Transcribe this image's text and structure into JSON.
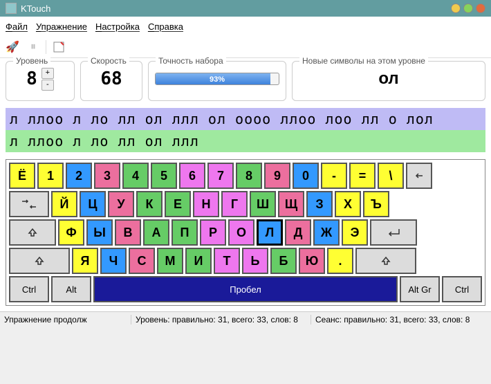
{
  "window": {
    "title": "KTouch"
  },
  "menu": {
    "file": "Файл",
    "exercise": "Упражнение",
    "settings": "Настройка",
    "help": "Справка"
  },
  "stats": {
    "level_label": "Уровень",
    "level_value": "8",
    "speed_label": "Скорость",
    "speed_value": "68",
    "accuracy_label": "Точность набора",
    "accuracy_pct": "93%",
    "accuracy_width": 93,
    "newchars_label": "Новые символы на этом уровне",
    "newchars_value": "ол"
  },
  "typing": {
    "target": "л ллоо л ло лл ол ллл ол оооо ллоо лоо лл о лол",
    "typed": "л ллоо л ло лл ол ллл"
  },
  "keyboard": {
    "rows": [
      [
        {
          "l": "Ё",
          "c": "yellow",
          "w": "1"
        },
        {
          "l": "1",
          "c": "yellow",
          "w": "1"
        },
        {
          "l": "2",
          "c": "blue",
          "w": "1"
        },
        {
          "l": "3",
          "c": "pink",
          "w": "1"
        },
        {
          "l": "4",
          "c": "green",
          "w": "1"
        },
        {
          "l": "5",
          "c": "green",
          "w": "1"
        },
        {
          "l": "6",
          "c": "magenta",
          "w": "1"
        },
        {
          "l": "7",
          "c": "magenta",
          "w": "1"
        },
        {
          "l": "8",
          "c": "green",
          "w": "1"
        },
        {
          "l": "9",
          "c": "pink",
          "w": "1"
        },
        {
          "l": "0",
          "c": "blue",
          "w": "1"
        },
        {
          "l": "-",
          "c": "yellow",
          "w": "1"
        },
        {
          "l": "=",
          "c": "yellow",
          "w": "1"
        },
        {
          "l": "\\",
          "c": "yellow",
          "w": "1"
        },
        {
          "l": "←",
          "c": "gray",
          "w": "1",
          "icon": "backspace"
        }
      ],
      [
        {
          "l": "⇥",
          "c": "gray",
          "w": "15",
          "icon": "tab"
        },
        {
          "l": "Й",
          "c": "yellow",
          "w": "1"
        },
        {
          "l": "Ц",
          "c": "blue",
          "w": "1"
        },
        {
          "l": "У",
          "c": "pink",
          "w": "1"
        },
        {
          "l": "К",
          "c": "green",
          "w": "1"
        },
        {
          "l": "Е",
          "c": "green",
          "w": "1"
        },
        {
          "l": "Н",
          "c": "magenta",
          "w": "1"
        },
        {
          "l": "Г",
          "c": "magenta",
          "w": "1"
        },
        {
          "l": "Ш",
          "c": "green",
          "w": "1"
        },
        {
          "l": "Щ",
          "c": "pink",
          "w": "1"
        },
        {
          "l": "З",
          "c": "blue",
          "w": "1"
        },
        {
          "l": "Х",
          "c": "yellow",
          "w": "1"
        },
        {
          "l": "Ъ",
          "c": "yellow",
          "w": "1"
        }
      ],
      [
        {
          "l": "⇩",
          "c": "gray",
          "w": "175",
          "icon": "caps"
        },
        {
          "l": "Ф",
          "c": "yellow",
          "w": "1"
        },
        {
          "l": "Ы",
          "c": "blue",
          "w": "1"
        },
        {
          "l": "В",
          "c": "pink",
          "w": "1"
        },
        {
          "l": "А",
          "c": "green",
          "w": "1"
        },
        {
          "l": "П",
          "c": "green",
          "w": "1"
        },
        {
          "l": "Р",
          "c": "magenta",
          "w": "1"
        },
        {
          "l": "О",
          "c": "magenta",
          "w": "1"
        },
        {
          "l": "Л",
          "c": "green",
          "w": "1",
          "hl": true
        },
        {
          "l": "Д",
          "c": "pink",
          "w": "1"
        },
        {
          "l": "Ж",
          "c": "blue",
          "w": "1"
        },
        {
          "l": "Э",
          "c": "yellow",
          "w": "1"
        },
        {
          "l": "↵",
          "c": "gray",
          "w": "175",
          "icon": "enter"
        }
      ],
      [
        {
          "l": "⇧",
          "c": "gray",
          "w": "225",
          "icon": "shift-left"
        },
        {
          "l": "Я",
          "c": "yellow",
          "w": "1"
        },
        {
          "l": "Ч",
          "c": "blue",
          "w": "1"
        },
        {
          "l": "С",
          "c": "pink",
          "w": "1"
        },
        {
          "l": "М",
          "c": "green",
          "w": "1"
        },
        {
          "l": "И",
          "c": "green",
          "w": "1"
        },
        {
          "l": "Т",
          "c": "magenta",
          "w": "1"
        },
        {
          "l": "Ь",
          "c": "magenta",
          "w": "1"
        },
        {
          "l": "Б",
          "c": "green",
          "w": "1"
        },
        {
          "l": "Ю",
          "c": "pink",
          "w": "1"
        },
        {
          "l": ".",
          "c": "yellow",
          "w": "1"
        },
        {
          "l": "⇧",
          "c": "gray",
          "w": "225",
          "icon": "shift-right"
        }
      ],
      [
        {
          "l": "Ctrl",
          "c": "gray",
          "w": "15",
          "small": true
        },
        {
          "l": "Alt",
          "c": "gray",
          "w": "15",
          "small": true
        },
        {
          "l": "Пробел",
          "c": "navy",
          "w": "space",
          "small": true
        },
        {
          "l": "Alt Gr",
          "c": "gray",
          "w": "15",
          "small": true
        },
        {
          "l": "Ctrl",
          "c": "gray",
          "w": "15",
          "small": true
        }
      ]
    ]
  },
  "status": {
    "seg1": "Упражнение продолж",
    "seg2": "Уровень: правильно: 31, всего: 33, слов: 8",
    "seg3": "Сеанс: правильно: 31, всего: 33, слов: 8"
  }
}
